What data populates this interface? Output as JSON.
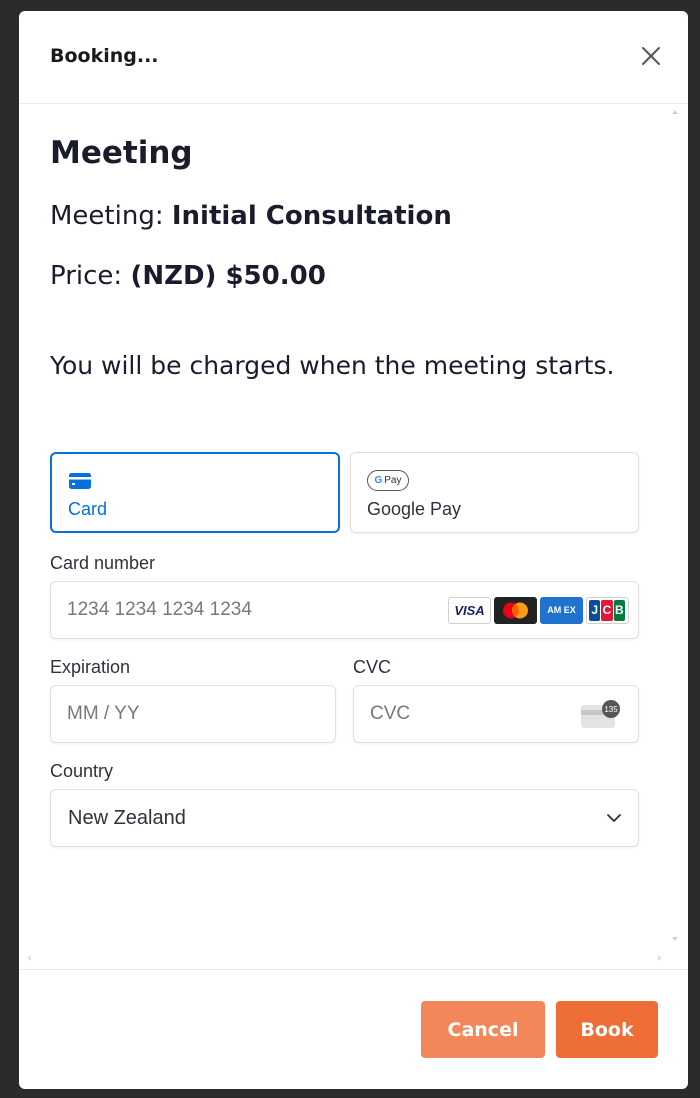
{
  "header": {
    "title": "Booking..."
  },
  "main": {
    "section_title": "Meeting",
    "meeting_label": "Meeting:",
    "meeting_value": "Initial Consultation",
    "price_label": "Price:",
    "price_value": "(NZD) $50.00",
    "charge_note": "You will be charged when the meeting starts."
  },
  "payment": {
    "tabs": [
      {
        "label": "Card",
        "icon": "credit-card-icon",
        "active": true
      },
      {
        "label": "Google Pay",
        "icon": "google-pay-icon",
        "active": false
      }
    ],
    "gpay_badge": {
      "g": "G",
      "text": "Pay"
    },
    "card_number": {
      "label": "Card number",
      "placeholder": "1234 1234 1234 1234"
    },
    "brands": {
      "visa": "VISA",
      "amex": "AM EX",
      "jcb": [
        "J",
        "C",
        "B"
      ]
    },
    "expiration": {
      "label": "Expiration",
      "placeholder": "MM / YY"
    },
    "cvc": {
      "label": "CVC",
      "placeholder": "CVC",
      "badge": "135"
    },
    "country": {
      "label": "Country",
      "value": "New Zealand"
    }
  },
  "footer": {
    "cancel_label": "Cancel",
    "book_label": "Book"
  },
  "colors": {
    "accent": "#0570de",
    "cancel": "#f2885a",
    "book": "#ef6d36"
  }
}
